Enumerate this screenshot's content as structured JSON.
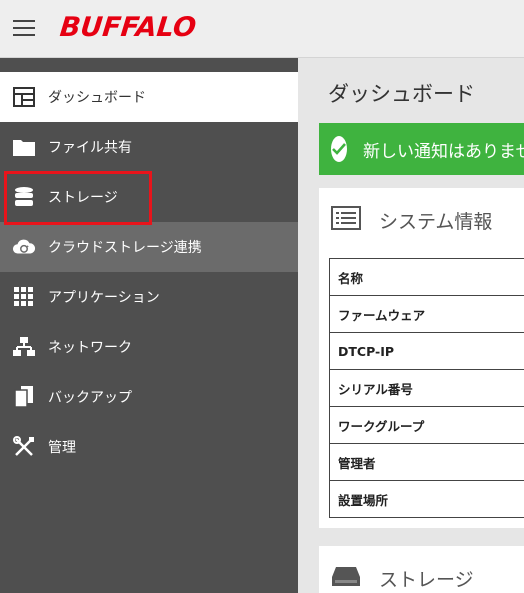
{
  "header": {
    "logo": "BUFFALO"
  },
  "sidebar": {
    "items": [
      {
        "label": "ダッシュボード",
        "icon": "dashboard-icon"
      },
      {
        "label": "ファイル共有",
        "icon": "folder-icon"
      },
      {
        "label": "ストレージ",
        "icon": "database-icon"
      },
      {
        "label": "クラウドストレージ連携",
        "icon": "cloud-sync-icon"
      },
      {
        "label": "アプリケーション",
        "icon": "grid-icon"
      },
      {
        "label": "ネットワーク",
        "icon": "network-icon"
      },
      {
        "label": "バックアップ",
        "icon": "backup-icon"
      },
      {
        "label": "管理",
        "icon": "tools-icon"
      }
    ]
  },
  "main": {
    "title": "ダッシュボード",
    "notification": "新しい通知はありません",
    "system_card": {
      "title": "システム情報",
      "rows": [
        "名称",
        "ファームウェア",
        "DTCP-IP",
        "シリアル番号",
        "ワークグループ",
        "管理者",
        "設置場所"
      ]
    },
    "storage_card": {
      "title": "ストレージ"
    }
  },
  "colors": {
    "brand": "#e60012",
    "sidebar_bg": "#4f4f4f",
    "notify_green": "#3fb33f",
    "highlight_red": "#e8141b"
  }
}
